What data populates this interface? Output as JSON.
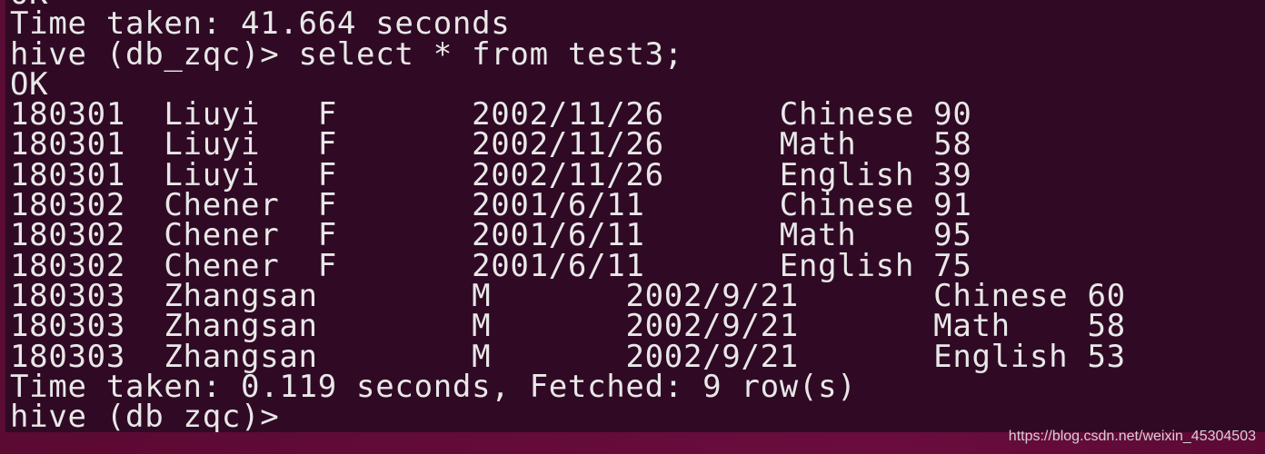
{
  "terminal": {
    "pre_lines": [
      "OK",
      "Time taken: 41.664 seconds",
      "hive (db_zqc)> select * from test3;",
      "OK"
    ],
    "rows": [
      [
        "180301",
        "Liuyi",
        "F",
        "2002/11/26",
        "Chinese",
        "90"
      ],
      [
        "180301",
        "Liuyi",
        "F",
        "2002/11/26",
        "Math",
        "58"
      ],
      [
        "180301",
        "Liuyi",
        "F",
        "2002/11/26",
        "English",
        "39"
      ],
      [
        "180302",
        "Chener",
        "F",
        "2001/6/11",
        "Chinese",
        "91"
      ],
      [
        "180302",
        "Chener",
        "F",
        "2001/6/11",
        "Math",
        "95"
      ],
      [
        "180302",
        "Chener",
        "F",
        "2001/6/11",
        "English",
        "75"
      ],
      [
        "180303",
        "Zhangsan",
        "M",
        "2002/9/21",
        "Chinese",
        "60"
      ],
      [
        "180303",
        "Zhangsan",
        "M",
        "2002/9/21",
        "Math",
        "58"
      ],
      [
        "180303",
        "Zhangsan",
        "M",
        "2002/9/21",
        "English",
        "53"
      ]
    ],
    "post_lines": [
      "Time taken: 0.119 seconds, Fetched: 9 row(s)",
      "hive (db_zqc)> "
    ]
  },
  "watermark": "https://blog.csdn.net/weixin_45304503",
  "colors": {
    "background": "#300a24",
    "text": "#e8e8e8",
    "accent": "#5e0a36"
  }
}
